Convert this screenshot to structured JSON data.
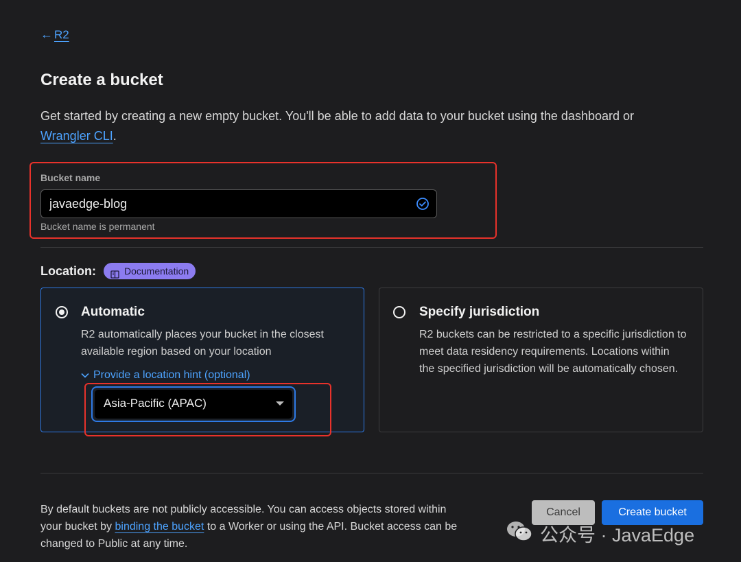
{
  "nav": {
    "back_label": "R2"
  },
  "header": {
    "title": "Create a bucket",
    "intro_text": "Get started by creating a new empty bucket. You'll be able to add data to your bucket using the dashboard or",
    "intro_link": "Wrangler CLI",
    "intro_end": "."
  },
  "bucket": {
    "label": "Bucket name",
    "value": "javaedge-blog",
    "hint": "Bucket name is permanent"
  },
  "location": {
    "label": "Location:",
    "doc_label": "Documentation",
    "automatic": {
      "title": "Automatic",
      "desc": "R2 automatically places your bucket in the closest available region based on your location",
      "hint_toggle": "Provide a location hint (optional)",
      "selected_hint": "Asia-Pacific (APAC)",
      "selected": true
    },
    "jurisdiction": {
      "title": "Specify jurisdiction",
      "desc": "R2 buckets can be restricted to a specific jurisdiction to meet data residency requirements. Locations within the specified jurisdiction will be automatically chosen.",
      "selected": false
    }
  },
  "footer": {
    "text_before": "By default buckets are not publicly accessible. You can access objects stored within your bucket by ",
    "link": "binding the bucket",
    "text_after": " to a Worker or using the API. Bucket access can be changed to Public at any time.",
    "cancel_label": "Cancel",
    "create_label": "Create bucket"
  },
  "watermark": {
    "text": "公众号 · JavaEdge"
  },
  "colors": {
    "accent": "#4da3ff",
    "primary_button": "#1a6fe0",
    "highlight": "#e8322b",
    "doc_pill": "#8c7cf0"
  }
}
